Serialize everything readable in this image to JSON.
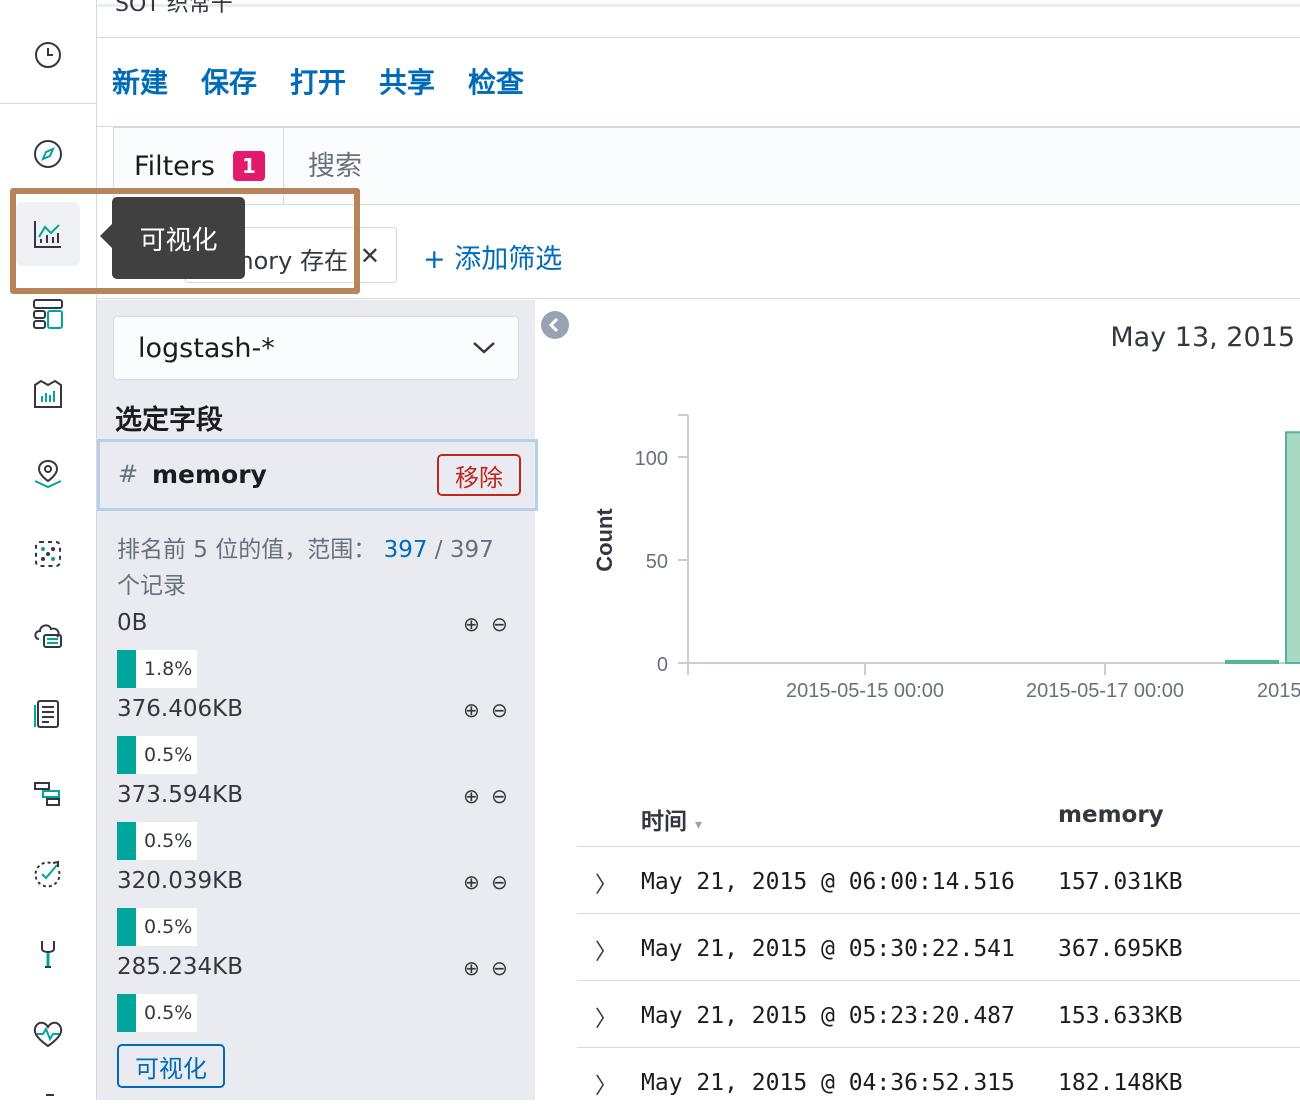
{
  "top": {
    "cut_title": "SOT 织常干"
  },
  "menu": {
    "items": [
      "新建",
      "保存",
      "打开",
      "共享",
      "检查"
    ]
  },
  "query": {
    "filters_label": "Filters",
    "filters_count": "1",
    "search_placeholder": "搜索"
  },
  "filter_bar": {
    "pill_label": "mory 存在",
    "add_filter": "+ 添加筛选"
  },
  "tooltip": {
    "text": "可视化"
  },
  "sidebar": {
    "index_pattern": "logstash-*",
    "selected_fields_title": "选定字段",
    "field": {
      "type_glyph": "#",
      "name": "memory",
      "remove": "移除"
    },
    "top_values_prefix": "排名前 5 位的值，范围：",
    "top_values_count": "397",
    "top_values_total": "/ 397",
    "top_values_suffix": "个记录",
    "values": [
      {
        "label": "0B",
        "percent": "1.8%",
        "fraction": 0.018
      },
      {
        "label": "376.406KB",
        "percent": "0.5%",
        "fraction": 0.005
      },
      {
        "label": "373.594KB",
        "percent": "0.5%",
        "fraction": 0.005
      },
      {
        "label": "320.039KB",
        "percent": "0.5%",
        "fraction": 0.005
      },
      {
        "label": "285.234KB",
        "percent": "0.5%",
        "fraction": 0.005
      }
    ],
    "visualize_button": "可视化"
  },
  "chart_header": {
    "date": "May 13, 2015"
  },
  "chart_data": {
    "type": "bar",
    "ylabel": "Count",
    "yticks": [
      "100",
      "50",
      "0"
    ],
    "xticks": [
      "2015-05-15 00:00",
      "2015-05-17 00:00",
      "2015"
    ],
    "series": [
      {
        "values": [
          1,
          112
        ]
      }
    ],
    "bar_color": "#54b399"
  },
  "table": {
    "col_time": "时间",
    "col_memory": "memory",
    "rows": [
      {
        "time": "May 21, 2015 @ 06:00:14.516",
        "memory": "157.031KB"
      },
      {
        "time": "May 21, 2015 @ 05:30:22.541",
        "memory": "367.695KB"
      },
      {
        "time": "May 21, 2015 @ 05:23:20.487",
        "memory": "153.633KB"
      },
      {
        "time": "May 21, 2015 @ 04:36:52.315",
        "memory": "182.148KB"
      }
    ]
  },
  "nav": {
    "icons": [
      "clock-icon",
      "compass-icon",
      "visualize-icon",
      "dashboard-icon",
      "canvas-icon",
      "maps-icon",
      "ml-icon",
      "infra-icon",
      "logs-icon",
      "apm-icon",
      "uptime-icon",
      "devtools-icon",
      "monitoring-icon"
    ]
  }
}
